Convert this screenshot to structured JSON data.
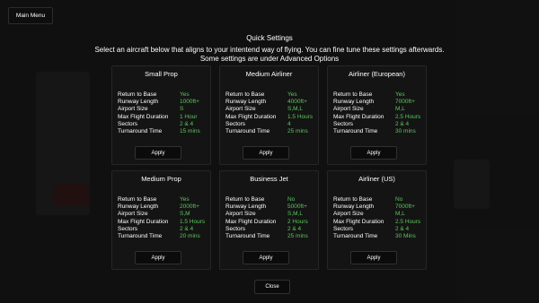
{
  "header": {
    "main_menu_label": "Main Menu",
    "title": "Quick Settings",
    "subtitle_line1": "Select an aircraft below that aligns to your intentend way of flying. You can fine tune these settings afterwards.",
    "subtitle_line2": "Some settings are under Advanced Options"
  },
  "colors": {
    "accent_value": "#5cc75c",
    "background": "#161616",
    "card": "#141414"
  },
  "cards": [
    {
      "title": "Small Prop",
      "apply": "Apply",
      "rows": [
        {
          "k": "Return to Base",
          "v": "Yes"
        },
        {
          "k": "Runway Length",
          "v": "1000ft+"
        },
        {
          "k": "Airport Size",
          "v": "S"
        },
        {
          "k": "Max Flight Duration",
          "v": "1 Hour"
        },
        {
          "k": "Sectors",
          "v": "2 & 4"
        },
        {
          "k": "Turnaround Time",
          "v": "15 mins"
        }
      ]
    },
    {
      "title": "Medium Airliner",
      "apply": "Apply",
      "rows": [
        {
          "k": "Return to Base",
          "v": "Yes"
        },
        {
          "k": "Runway Length",
          "v": "4000ft+"
        },
        {
          "k": "Airport Size",
          "v": "S,M,L"
        },
        {
          "k": "Max Flight Duration",
          "v": "1.5 Hours"
        },
        {
          "k": "Sectors",
          "v": "4"
        },
        {
          "k": "Turnaround Time",
          "v": "25 mins"
        }
      ]
    },
    {
      "title": "Airliner (European)",
      "apply": "Apply",
      "rows": [
        {
          "k": "Return to Base",
          "v": "Yes"
        },
        {
          "k": "Runway Length",
          "v": "7000ft+"
        },
        {
          "k": "Airport Size",
          "v": "M,L"
        },
        {
          "k": "Max Flight Duration",
          "v": "2.5 Hours"
        },
        {
          "k": "Sectors",
          "v": "2 & 4"
        },
        {
          "k": "Turnaround Time",
          "v": "30 mins"
        }
      ]
    },
    {
      "title": "Medium Prop",
      "apply": "Apply",
      "rows": [
        {
          "k": "Return to Base",
          "v": "Yes"
        },
        {
          "k": "Runway Length",
          "v": "2000ft+"
        },
        {
          "k": "Airport Size",
          "v": "S,M"
        },
        {
          "k": "Max Flight Duration",
          "v": "1.5 Hours"
        },
        {
          "k": "Sectors",
          "v": "2 & 4"
        },
        {
          "k": "Turnaround Time",
          "v": "20 mins"
        }
      ]
    },
    {
      "title": "Business Jet",
      "apply": "Apply",
      "rows": [
        {
          "k": "Return to Base",
          "v": "No"
        },
        {
          "k": "Runway Length",
          "v": "5000ft+"
        },
        {
          "k": "Airport Size",
          "v": "S,M,L"
        },
        {
          "k": "Max Flight Duration",
          "v": "2 Hours"
        },
        {
          "k": "Sectors",
          "v": "2 & 4"
        },
        {
          "k": "Turnaround Time",
          "v": "25 mins"
        }
      ]
    },
    {
      "title": "Airliner (US)",
      "apply": "Apply",
      "rows": [
        {
          "k": "Return to Base",
          "v": "No"
        },
        {
          "k": "Runway Length",
          "v": "7000ft+"
        },
        {
          "k": "Airport Size",
          "v": "M,L"
        },
        {
          "k": "Max Flight Duration",
          "v": "2.5 Hours"
        },
        {
          "k": "Sectors",
          "v": "2 & 4"
        },
        {
          "k": "Turnaround Time",
          "v": "30 Mins"
        }
      ]
    }
  ],
  "footer": {
    "close_label": "Close"
  }
}
